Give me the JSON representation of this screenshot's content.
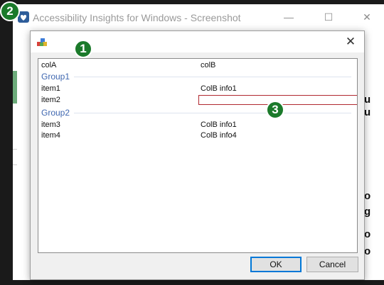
{
  "background_window": {
    "title": "Accessibility Insights for Windows - Screenshot",
    "controls": [
      "—",
      "☐",
      "✕"
    ],
    "right_fragments": [
      "u",
      "u",
      "o",
      "g",
      "o",
      "o"
    ]
  },
  "dialog": {
    "close_label": "✕",
    "list": {
      "headers": {
        "colA": "colA",
        "colB": "colB"
      },
      "groups": [
        {
          "name": "Group1",
          "rows": [
            {
              "a": "item1",
              "b": "ColB info1"
            },
            {
              "a": "item2",
              "b": ""
            }
          ]
        },
        {
          "name": "Group2",
          "rows": [
            {
              "a": "item3",
              "b": "ColB info1"
            },
            {
              "a": "item4",
              "b": "ColB info4"
            }
          ]
        }
      ]
    },
    "buttons": {
      "ok": "OK",
      "cancel": "Cancel"
    }
  },
  "callouts": {
    "one": "1",
    "two": "2",
    "three": "3"
  },
  "colors": {
    "callout": "#1b7a2b",
    "group_header": "#3f67b0",
    "selection_border": "#b0282f",
    "accent": "#6cab7a"
  }
}
